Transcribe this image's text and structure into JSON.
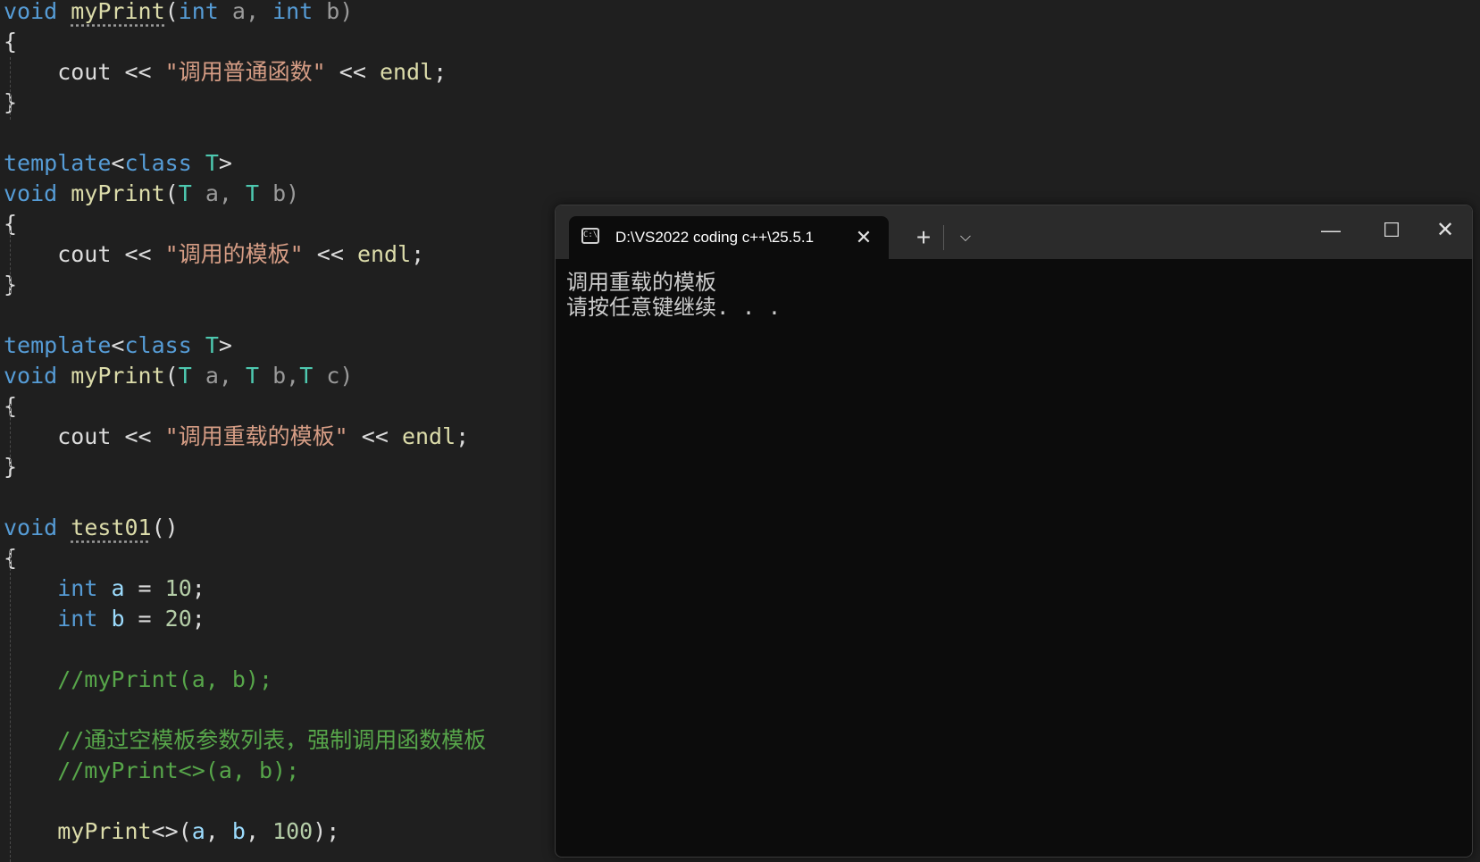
{
  "editor": {
    "lines": [
      [
        {
          "t": "void",
          "c": "kw"
        },
        {
          "t": " ",
          "c": "pl"
        },
        {
          "t": "myPrint",
          "c": "fn sq"
        },
        {
          "t": "(",
          "c": "pl"
        },
        {
          "t": "int",
          "c": "kw"
        },
        {
          "t": " a, ",
          "c": "pm"
        },
        {
          "t": "int",
          "c": "kw"
        },
        {
          "t": " b)",
          "c": "pm"
        }
      ],
      [
        {
          "t": "{",
          "c": "pl"
        }
      ],
      [
        {
          "t": "    cout << ",
          "c": "pl"
        },
        {
          "t": "\"调用普通函数\"",
          "c": "st"
        },
        {
          "t": " << ",
          "c": "pl"
        },
        {
          "t": "endl",
          "c": "fn"
        },
        {
          "t": ";",
          "c": "pl"
        }
      ],
      [
        {
          "t": "}",
          "c": "pl"
        }
      ],
      [],
      [
        {
          "t": "template",
          "c": "kw"
        },
        {
          "t": "<",
          "c": "pl"
        },
        {
          "t": "class",
          "c": "kw"
        },
        {
          "t": " ",
          "c": "pl"
        },
        {
          "t": "T",
          "c": "tp"
        },
        {
          "t": ">",
          "c": "pl"
        }
      ],
      [
        {
          "t": "void",
          "c": "kw"
        },
        {
          "t": " ",
          "c": "pl"
        },
        {
          "t": "myPrint",
          "c": "fn"
        },
        {
          "t": "(",
          "c": "pl"
        },
        {
          "t": "T",
          "c": "tp"
        },
        {
          "t": " a, ",
          "c": "pm"
        },
        {
          "t": "T",
          "c": "tp"
        },
        {
          "t": " b)",
          "c": "pm"
        }
      ],
      [
        {
          "t": "{",
          "c": "pl"
        }
      ],
      [
        {
          "t": "    cout << ",
          "c": "pl"
        },
        {
          "t": "\"调用的模板\"",
          "c": "st"
        },
        {
          "t": " << ",
          "c": "pl"
        },
        {
          "t": "endl",
          "c": "fn"
        },
        {
          "t": ";",
          "c": "pl"
        }
      ],
      [
        {
          "t": "}",
          "c": "pl"
        }
      ],
      [],
      [
        {
          "t": "template",
          "c": "kw"
        },
        {
          "t": "<",
          "c": "pl"
        },
        {
          "t": "class",
          "c": "kw"
        },
        {
          "t": " ",
          "c": "pl"
        },
        {
          "t": "T",
          "c": "tp"
        },
        {
          "t": ">",
          "c": "pl"
        }
      ],
      [
        {
          "t": "void",
          "c": "kw"
        },
        {
          "t": " ",
          "c": "pl"
        },
        {
          "t": "myPrint",
          "c": "fn"
        },
        {
          "t": "(",
          "c": "pl"
        },
        {
          "t": "T",
          "c": "tp"
        },
        {
          "t": " a, ",
          "c": "pm"
        },
        {
          "t": "T",
          "c": "tp"
        },
        {
          "t": " b,",
          "c": "pm"
        },
        {
          "t": "T",
          "c": "tp"
        },
        {
          "t": " c)",
          "c": "pm"
        }
      ],
      [
        {
          "t": "{",
          "c": "pl"
        }
      ],
      [
        {
          "t": "    cout << ",
          "c": "pl"
        },
        {
          "t": "\"调用重载的模板\"",
          "c": "st"
        },
        {
          "t": " << ",
          "c": "pl"
        },
        {
          "t": "endl",
          "c": "fn"
        },
        {
          "t": ";",
          "c": "pl"
        }
      ],
      [
        {
          "t": "}",
          "c": "pl"
        }
      ],
      [],
      [
        {
          "t": "void",
          "c": "kw"
        },
        {
          "t": " ",
          "c": "pl"
        },
        {
          "t": "test01",
          "c": "fn sq"
        },
        {
          "t": "()",
          "c": "pl"
        }
      ],
      [
        {
          "t": "{",
          "c": "pl"
        }
      ],
      [
        {
          "t": "    ",
          "c": "pl"
        },
        {
          "t": "int",
          "c": "kw"
        },
        {
          "t": " ",
          "c": "pl"
        },
        {
          "t": "a",
          "c": "vr"
        },
        {
          "t": " = ",
          "c": "pl"
        },
        {
          "t": "10",
          "c": "nm"
        },
        {
          "t": ";",
          "c": "pl"
        }
      ],
      [
        {
          "t": "    ",
          "c": "pl"
        },
        {
          "t": "int",
          "c": "kw"
        },
        {
          "t": " ",
          "c": "pl"
        },
        {
          "t": "b",
          "c": "vr"
        },
        {
          "t": " = ",
          "c": "pl"
        },
        {
          "t": "20",
          "c": "nm"
        },
        {
          "t": ";",
          "c": "pl"
        }
      ],
      [],
      [
        {
          "t": "    //myPrint(a, b);",
          "c": "cm"
        }
      ],
      [],
      [
        {
          "t": "    //通过空模板参数列表，强制调用函数模板",
          "c": "cm"
        }
      ],
      [
        {
          "t": "    //myPrint<>(a, b);",
          "c": "cm"
        }
      ],
      [],
      [
        {
          "t": "    ",
          "c": "pl"
        },
        {
          "t": "myPrint",
          "c": "fn"
        },
        {
          "t": "<>(",
          "c": "pl"
        },
        {
          "t": "a",
          "c": "vr"
        },
        {
          "t": ", ",
          "c": "pl"
        },
        {
          "t": "b",
          "c": "vr"
        },
        {
          "t": ", ",
          "c": "pl"
        },
        {
          "t": "100",
          "c": "nm"
        },
        {
          "t": ");",
          "c": "pl"
        }
      ]
    ]
  },
  "console": {
    "tab_icon": "C:\\",
    "tab_title": "D:\\VS2022 coding c++\\25.5.1",
    "new_tab_label": "+",
    "dropdown_label": "⌵",
    "minimize_label": "—",
    "maximize_label": "☐",
    "close_label": "✕",
    "tab_close_label": "✕",
    "output": [
      "调用重载的模板",
      "请按任意键继续. . ."
    ]
  },
  "colors": {
    "editor_bg": "#1f1f1f",
    "keyword": "#569cd6",
    "function": "#dcdcaa",
    "type_param": "#4ec9b0",
    "string": "#d69d85",
    "comment": "#57a64a",
    "number": "#b5cea8",
    "console_bg": "#0c0c0c",
    "titlebar_bg": "#2b2b2b"
  }
}
